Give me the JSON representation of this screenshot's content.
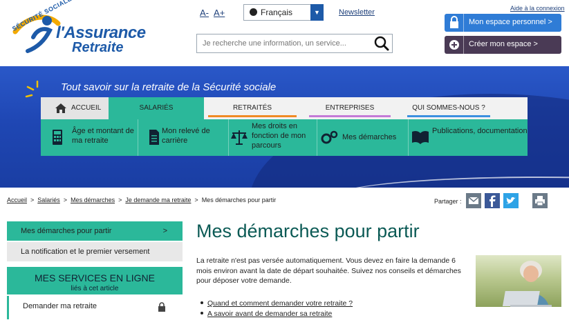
{
  "header": {
    "logo_top": "SÉCURITÉ SOCIALE",
    "logo_line1": "l'Assurance",
    "logo_line2": "Retraite",
    "font_decrease": "A-",
    "font_increase": "A+",
    "language": "Français",
    "newsletter": "Newsletter",
    "search_placeholder": "Je recherche une information, un service...",
    "help_link": "Aide à la connexion",
    "account_button": "Mon espace personnel >",
    "create_button": "Créer mon espace >"
  },
  "banner": {
    "tagline": "Tout savoir sur la retraite de la Sécurité sociale"
  },
  "nav": {
    "items": [
      {
        "label": "Accueil"
      },
      {
        "label": "Salariés"
      },
      {
        "label": "Retraités",
        "color": "#f08a24"
      },
      {
        "label": "Entreprises",
        "color": "#c47ad8"
      },
      {
        "label": "Qui sommes-nous ?",
        "color": "#3b8fe0"
      }
    ]
  },
  "subnav": {
    "items": [
      {
        "label": "Âge et montant de ma retraite",
        "icon": "calculator-icon"
      },
      {
        "label": "Mon relevé de carrière",
        "icon": "document-icon"
      },
      {
        "label": "Mes droits en fonction de mon parcours",
        "icon": "scales-icon"
      },
      {
        "label": "Mes démarches",
        "icon": "gears-icon"
      },
      {
        "label": "Publications, documentation",
        "icon": "book-icon"
      }
    ]
  },
  "breadcrumb": {
    "items": [
      "Accueil",
      "Salariés",
      "Mes démarches",
      "Je demande ma retraite"
    ],
    "current": "Mes démarches pour partir",
    "share_label": "Partager :"
  },
  "sidebar": {
    "active_item": "Mes démarches pour partir",
    "active_arrow": ">",
    "item_2": "La notification et le premier versement",
    "services_title": "MES SERVICES EN LIGNE",
    "services_subtitle": "liés à cet article",
    "service_item": "Demander ma retraite"
  },
  "main": {
    "title": "Mes démarches pour partir",
    "intro": "La retraite n'est pas versée automatiquement. Vous devez en faire la demande 6 mois environ avant la date de départ souhaitée. Suivez nos conseils et démarches pour déposer votre demande.",
    "links": [
      "Quand et comment demander votre retraite ?",
      "A savoir avant de demander sa retraite"
    ]
  },
  "colors": {
    "brand_blue": "#1d5aa8",
    "teal": "#2bb89a",
    "title_teal": "#0b5a55",
    "account_blue": "#2f7cd6",
    "account_purple": "#4a3a55"
  }
}
